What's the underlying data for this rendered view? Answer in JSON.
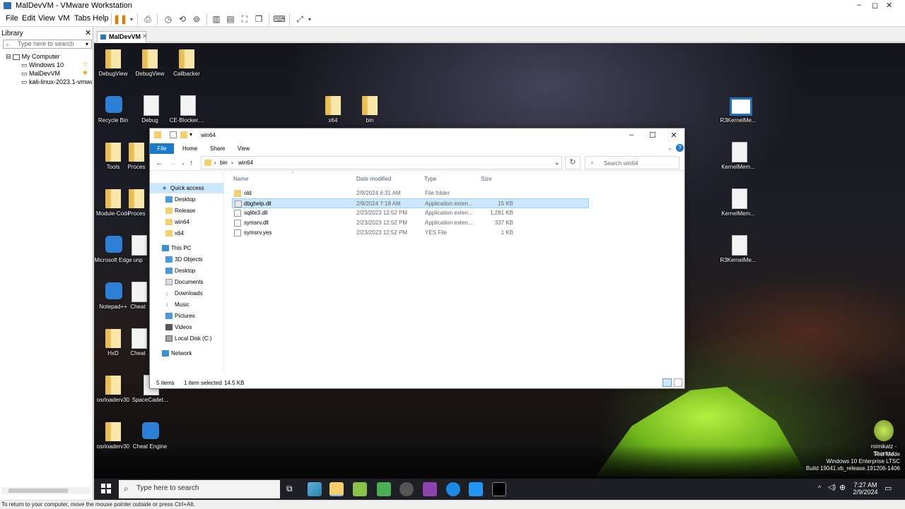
{
  "vmware": {
    "title": "MalDevVM - VMware Workstation",
    "menu": [
      "File",
      "Edit",
      "View",
      "VM",
      "Tabs",
      "Help"
    ],
    "library": {
      "header": "Library",
      "search_placeholder": "Type here to search",
      "tree": [
        "My Computer",
        "Windows 10",
        "MalDevVM",
        "kali-linux-2023.1-vmware"
      ]
    },
    "tab_label": "MalDevVM",
    "status_hint": "To return to your computer, move the mouse pointer outside or press Ctrl+Alt."
  },
  "desktop": {
    "icons": [
      "DebugView",
      "DebugView",
      "Callbacker",
      "Recycle Bin",
      "Debug",
      "CE-Blocker....",
      "x64",
      "bin",
      "R3KernelMe...",
      "KernelMem...",
      "KernelMem...",
      "R3KernelMe...",
      "Tools",
      "Proces",
      "Module-Code",
      "Proces",
      "Microsoft Edge",
      "unp",
      "Notepad++",
      "Cheat",
      "HxD",
      "Cheat",
      "osrloaderv30",
      "SpaceCadet...",
      "osrloaderv30",
      "Cheat Engine",
      "mimikatz - Shortcut"
    ],
    "watermark": [
      "Test Mode",
      "Windows 10 Enterprise LTSC",
      "Build 19041.vb_release.191206-1406"
    ]
  },
  "explorer": {
    "title": "win64",
    "ribbon": [
      "File",
      "Home",
      "Share",
      "View"
    ],
    "breadcrumb": [
      "bin",
      "win64"
    ],
    "search_placeholder": "Search win64",
    "nav": {
      "quick_access": "Quick access",
      "qa_items": [
        "Desktop",
        "Release",
        "win64",
        "x64"
      ],
      "this_pc": "This PC",
      "pc_items": [
        "3D Objects",
        "Desktop",
        "Documents",
        "Downloads",
        "Music",
        "Pictures",
        "Videos",
        "Local Disk (C:)"
      ],
      "network": "Network"
    },
    "columns": [
      "Name",
      "Date modified",
      "Type",
      "Size"
    ],
    "files": [
      {
        "name": "old",
        "date": "2/9/2024 6:31 AM",
        "type": "File folder",
        "size": ""
      },
      {
        "name": "dbghelp.dll",
        "date": "2/9/2024 7:18 AM",
        "type": "Application exten...",
        "size": "15 KB"
      },
      {
        "name": "sqlite3.dll",
        "date": "2/23/2023 12:52 PM",
        "type": "Application exten...",
        "size": "1,281 KB"
      },
      {
        "name": "symsrv.dll",
        "date": "2/23/2023 12:52 PM",
        "type": "Application exten...",
        "size": "337 KB"
      },
      {
        "name": "symsrv.yes",
        "date": "2/23/2023 12:52 PM",
        "type": "YES File",
        "size": "1 KB"
      }
    ],
    "status": {
      "items": "5 items",
      "selected": "1 item selected",
      "size": "14.5 KB"
    }
  },
  "taskbar": {
    "search_placeholder": "Type here to search",
    "time": "7:27 AM",
    "date": "2/9/2024"
  }
}
